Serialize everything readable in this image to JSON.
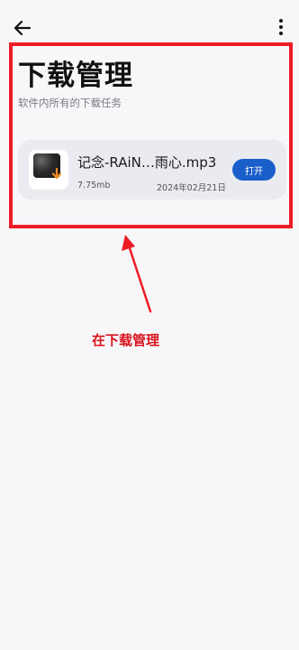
{
  "header": {
    "title": "下载管理",
    "subtitle": "软件内所有的下载任务",
    "back_icon": "arrow-left-icon",
    "more_icon": "more-vertical-icon"
  },
  "downloads": [
    {
      "file_name": "记念-RAiN…雨心.mp3",
      "size": "7.75mb",
      "date": "2024年02月21日",
      "action_label": "打开",
      "thumbnail_icon": "album-art-thumbnail"
    }
  ],
  "annotation": {
    "label": "在下载管理",
    "color": "#ee1c25"
  },
  "colors": {
    "accent": "#1a5fc9",
    "annotation_red": "#ee1c25"
  }
}
